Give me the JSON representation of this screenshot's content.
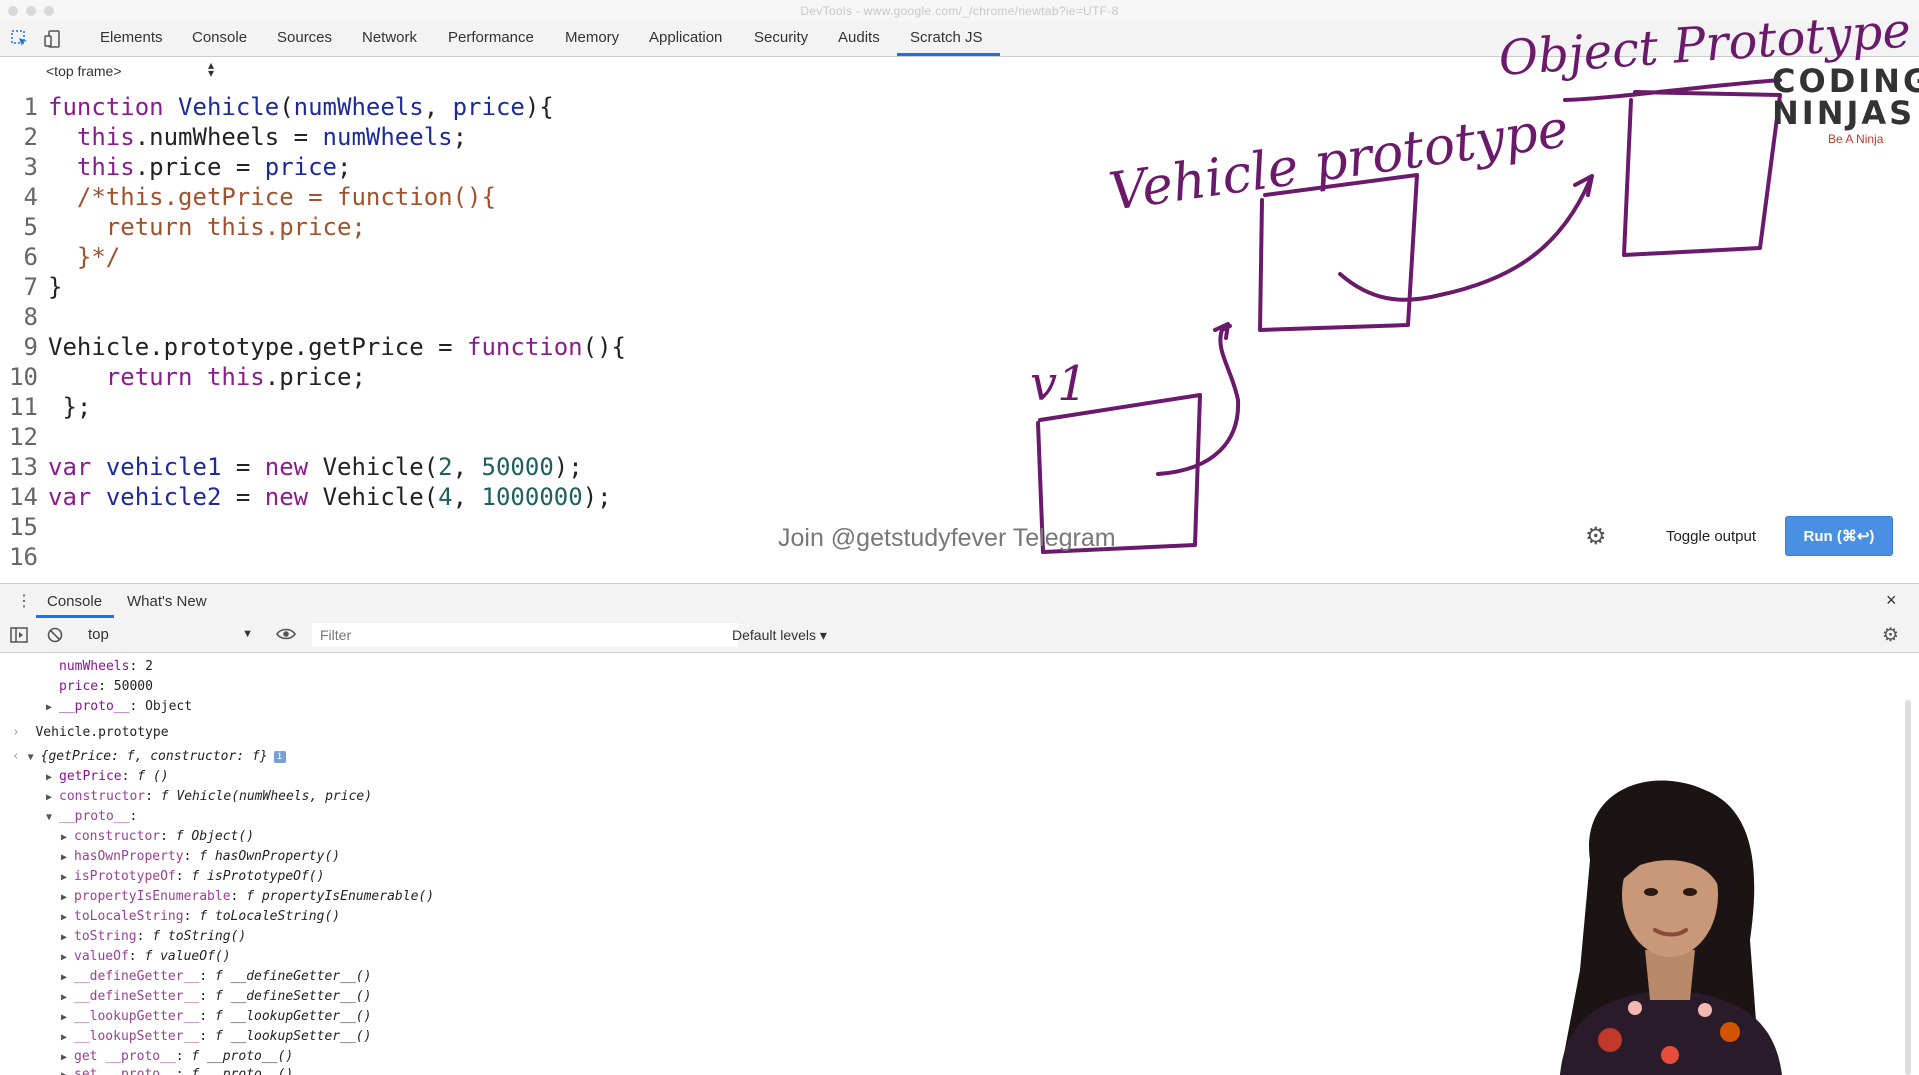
{
  "window": {
    "title": "DevTools - www.google.com/_/chrome/newtab?ie=UTF-8"
  },
  "tabs": [
    "Elements",
    "Console",
    "Sources",
    "Network",
    "Performance",
    "Memory",
    "Application",
    "Security",
    "Audits",
    "Scratch JS"
  ],
  "active_tab": "Scratch JS",
  "frame_select": "<top frame>",
  "code": [
    {
      "n": "1"
    },
    {
      "n": "2"
    },
    {
      "n": "3"
    },
    {
      "n": "4"
    },
    {
      "n": "5"
    },
    {
      "n": "6"
    },
    {
      "n": "7"
    },
    {
      "n": "8"
    },
    {
      "n": "9"
    },
    {
      "n": "10"
    },
    {
      "n": "11"
    },
    {
      "n": "12"
    },
    {
      "n": "13"
    },
    {
      "n": "14"
    },
    {
      "n": "15"
    },
    {
      "n": "16"
    }
  ],
  "code_text": {
    "l1_kw": "function",
    "l1_fn": "Vehicle",
    "l1_rest": "(",
    "l1_p1": "numWheels",
    "l1_c": ", ",
    "l1_p2": "price",
    "l1_end": "){",
    "l2_a": "this",
    "l2_b": ".numWheels = ",
    "l2_c": "numWheels",
    "l2_d": ";",
    "l3_a": "this",
    "l3_b": ".price = ",
    "l3_c": "price",
    "l3_d": ";",
    "l4": "/*this.getPrice = function(){",
    "l5": "return this.price;",
    "l6": "}*/",
    "l7": "}",
    "l9_a": "Vehicle.prototype.getPrice = ",
    "l9_b": "function",
    "l9_c": "(){",
    "l10_a": "return",
    "l10_b": " ",
    "l10_c": "this",
    "l10_d": ".price;",
    "l11": "};",
    "l13_a": "var",
    "l13_b": "vehicle1",
    "l13_c": " = ",
    "l13_d": "new",
    "l13_e": " Vehicle(",
    "l13_f": "2",
    "l13_g": ", ",
    "l13_h": "50000",
    "l13_i": ");",
    "l14_a": "var",
    "l14_b": "vehicle2",
    "l14_c": " = ",
    "l14_d": "new",
    "l14_e": " Vehicle(",
    "l14_f": "4",
    "l14_g": ", ",
    "l14_h": "1000000",
    "l14_i": ");"
  },
  "annotations": {
    "object_prototype": "Object Prototype",
    "vehicle_prototype": "Vehicle prototype",
    "v1": "v1"
  },
  "logo": {
    "line1": "CODING",
    "line2": "NINJAS",
    "tagline": "Be A Ninja"
  },
  "watermark": "Join @getstudyfever Telegram",
  "scratch_buttons": {
    "toggle_output": "Toggle output",
    "run": "Run (⌘↩)"
  },
  "drawer": {
    "tabs": [
      "Console",
      "What's New"
    ],
    "close_icon": "×"
  },
  "console_toolbar": {
    "context": "top",
    "filter_placeholder": "Filter",
    "levels": "Default levels"
  },
  "console": {
    "obj_lines": [
      {
        "k": "numWheels",
        "v": "2"
      },
      {
        "k": "price",
        "v": "50000"
      }
    ],
    "proto_line": {
      "k": "__proto__",
      "v": "Object"
    },
    "input": "Vehicle.prototype",
    "result_summary": "{getPrice: f, constructor: f}",
    "result_props": [
      {
        "k": "getPrice",
        "v": "f ()"
      },
      {
        "k": "constructor",
        "v": "f Vehicle(numWheels, price)"
      }
    ],
    "proto_label": "__proto__",
    "proto_props": [
      {
        "k": "constructor",
        "v": "f Object()"
      },
      {
        "k": "hasOwnProperty",
        "v": "f hasOwnProperty()"
      },
      {
        "k": "isPrototypeOf",
        "v": "f isPrototypeOf()"
      },
      {
        "k": "propertyIsEnumerable",
        "v": "f propertyIsEnumerable()"
      },
      {
        "k": "toLocaleString",
        "v": "f toLocaleString()"
      },
      {
        "k": "toString",
        "v": "f toString()"
      },
      {
        "k": "valueOf",
        "v": "f valueOf()"
      },
      {
        "k": "__defineGetter__",
        "v": "f __defineGetter__()"
      },
      {
        "k": "__defineSetter__",
        "v": "f __defineSetter__()"
      },
      {
        "k": "__lookupGetter__",
        "v": "f __lookupGetter__()"
      },
      {
        "k": "__lookupSetter__",
        "v": "f __lookupSetter__()"
      },
      {
        "k": "get __proto__",
        "v": "f __proto__()"
      },
      {
        "k": "set __proto__",
        "v": "f __proto__()"
      }
    ]
  },
  "colors": {
    "accent": "#1a73e8",
    "run_button": "#4a90e2",
    "ink": "#6b1a6b",
    "keyword": "#8a1d8e",
    "function_name": "#1d2a9b"
  }
}
